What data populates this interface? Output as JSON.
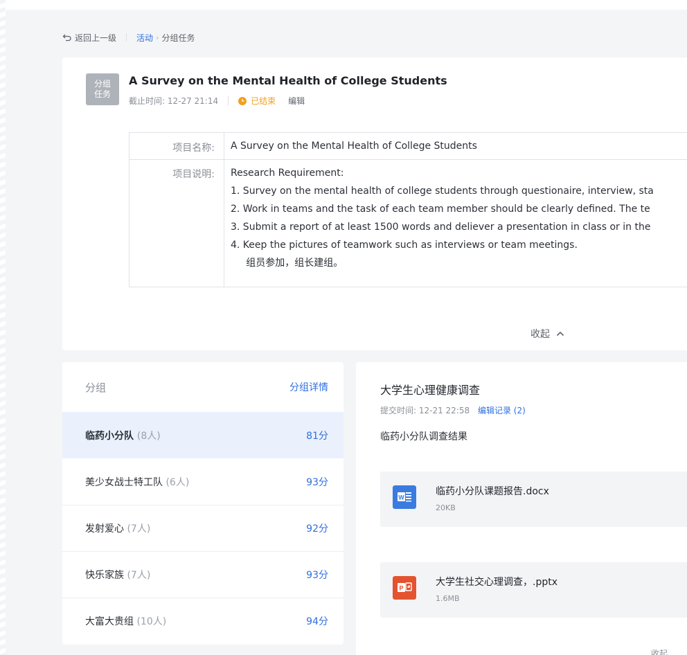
{
  "breadcrumb": {
    "back": "返回上一级",
    "activity": "活动",
    "current": "分组任务"
  },
  "task": {
    "tag_line1": "分组",
    "tag_line2": "任务",
    "title": "A Survey on the Mental Health of College Students",
    "deadline": "截止时间: 12-27 21:14",
    "status": "已结束",
    "status_color": "#f0a020",
    "edit": "编辑"
  },
  "info": {
    "name_label": "项目名称:",
    "name_value": "A Survey on the Mental Health of College Students",
    "desc_label": "项目说明:",
    "desc_lines": [
      "Research Requirement:",
      "1.  Survey on the mental health of college students through questionaire, interview, sta",
      "2.  Work in teams and the task of each team member should be clearly defined. The te",
      "3.  Submit a report of at least 1500 words and deliever a presentation in class or in the",
      "4.  Keep the pictures of teamwork such as  interviews or team meetings.",
      "     组员参加，组长建组。"
    ]
  },
  "collapse_label": "收起",
  "groups": {
    "header": "分组",
    "detail_link": "分组详情",
    "items": [
      {
        "name": "临药小分队",
        "count": "(8人)",
        "score": "81分",
        "active": true
      },
      {
        "name": "美少女战士特工队",
        "count": "(6人)",
        "score": "93分"
      },
      {
        "name": "发射爱心",
        "count": "(7人)",
        "score": "92分"
      },
      {
        "name": "快乐家族",
        "count": "(7人)",
        "score": "93分"
      },
      {
        "name": "大富大贵组",
        "count": "(10人)",
        "score": "94分"
      }
    ]
  },
  "submission": {
    "title": "大学生心理健康调查",
    "submit_time": "提交时间: 12-21 22:58",
    "edit_record": "编辑记录 (2)",
    "description": "临药小分队调查结果",
    "files": [
      {
        "name": "临药小分队课题报告.docx",
        "size": "20KB",
        "icon": "word-icon",
        "color": "#3a7be0"
      },
      {
        "name": "大学生社交心理调查，.pptx",
        "size": "1.6MB",
        "icon": "powerpoint-icon",
        "color": "#e4532f"
      }
    ],
    "bottom_cut": "收起"
  },
  "colors": {
    "accent": "#2f6fe0",
    "active_row": "#eaf1fd",
    "page_bg": "#f4f5f7"
  }
}
